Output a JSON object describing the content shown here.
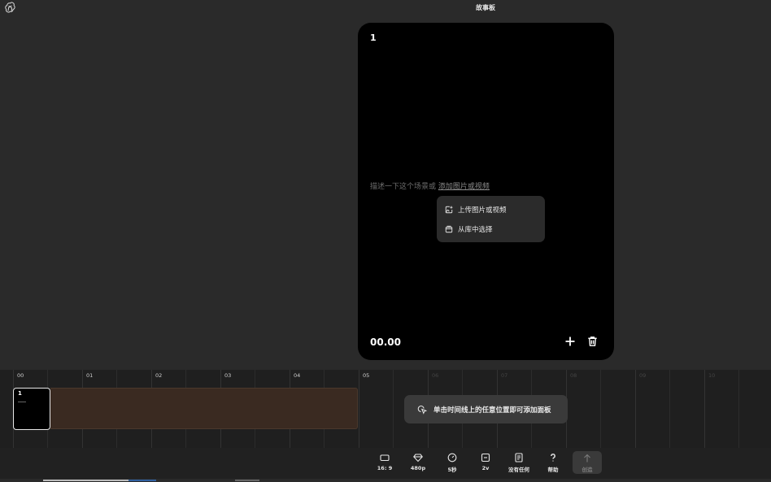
{
  "header": {
    "title": "故事板",
    "logo_icon": "openai-logo-icon"
  },
  "card": {
    "index": "1",
    "prompt_text": "描述一下这个场景或",
    "prompt_link": "添加图片或视频",
    "time": "00.00",
    "add_icon": "plus-icon",
    "delete_icon": "trash-icon",
    "menu": {
      "items": [
        {
          "label": "上传图片或视频",
          "icon": "upload-media-icon"
        },
        {
          "label": "从库中选择",
          "icon": "library-icon"
        }
      ]
    }
  },
  "timeline": {
    "labels": [
      "00",
      "01",
      "02",
      "03",
      "04",
      "05",
      "06",
      "07",
      "08",
      "09",
      "10"
    ],
    "clip": {
      "index": "1"
    },
    "hint": "单击时间线上的任意位置即可添加面板"
  },
  "toolbar": {
    "items": [
      {
        "label": "16: 9",
        "icon": "aspect-ratio-icon"
      },
      {
        "label": "480p",
        "icon": "resolution-icon"
      },
      {
        "label": "5秒",
        "icon": "duration-icon"
      },
      {
        "label": "2v",
        "icon": "variations-icon"
      },
      {
        "label": "没有任何",
        "icon": "preset-icon"
      },
      {
        "label": "帮助",
        "icon": "help-icon"
      },
      {
        "label": "创造",
        "icon": "arrow-up-icon"
      }
    ]
  }
}
